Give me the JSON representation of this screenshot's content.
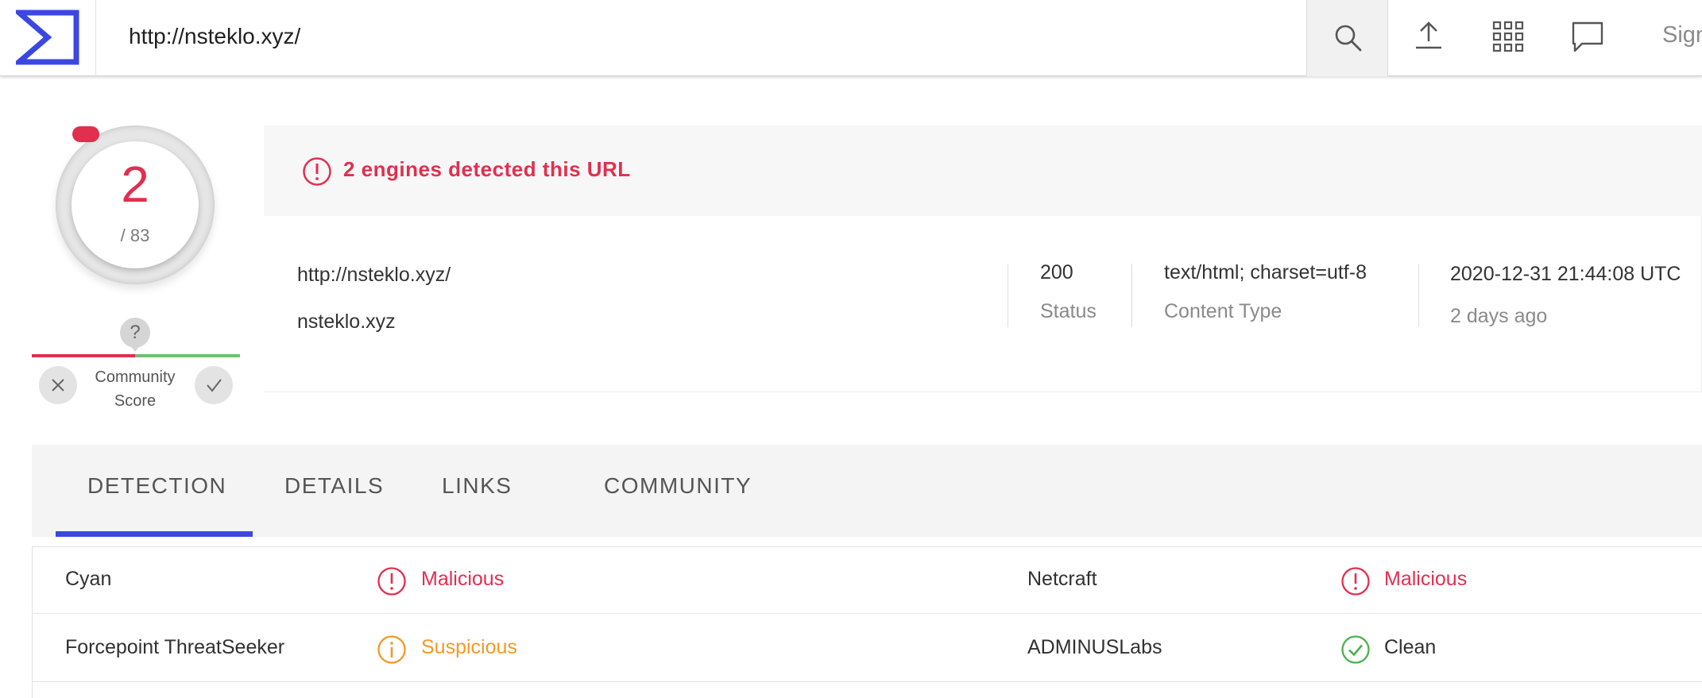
{
  "header": {
    "search_value": "http://nsteklo.xyz/",
    "signin_label": "Sign in"
  },
  "score": {
    "detections": "2",
    "total": "/ 83",
    "community_help": "?",
    "community_label_line1": "Community",
    "community_label_line2": "Score"
  },
  "summary": {
    "alert_text": "2 engines detected this URL",
    "url": "http://nsteklo.xyz/",
    "domain": "nsteklo.xyz",
    "status_value": "200",
    "status_label": "Status",
    "content_type_value": "text/html; charset=utf-8",
    "content_type_label": "Content Type",
    "date_value": "2020-12-31 21:44:08 UTC",
    "date_relative": "2 days ago"
  },
  "tabs": {
    "detection": "DETECTION",
    "details": "DETAILS",
    "links": "LINKS",
    "community": "COMMUNITY",
    "active": "DETECTION"
  },
  "results": [
    {
      "engine": "Cyan",
      "verdict": "Malicious",
      "status": "malicious"
    },
    {
      "engine": "Netcraft",
      "verdict": "Malicious",
      "status": "malicious"
    },
    {
      "engine": "Forcepoint ThreatSeeker",
      "verdict": "Suspicious",
      "status": "suspicious"
    },
    {
      "engine": "ADMINUSLabs",
      "verdict": "Clean",
      "status": "clean"
    }
  ],
  "colors": {
    "malicious": "#e12f4f",
    "suspicious": "#f19a25",
    "clean": "#4caf50",
    "accent": "#3b48e0"
  }
}
